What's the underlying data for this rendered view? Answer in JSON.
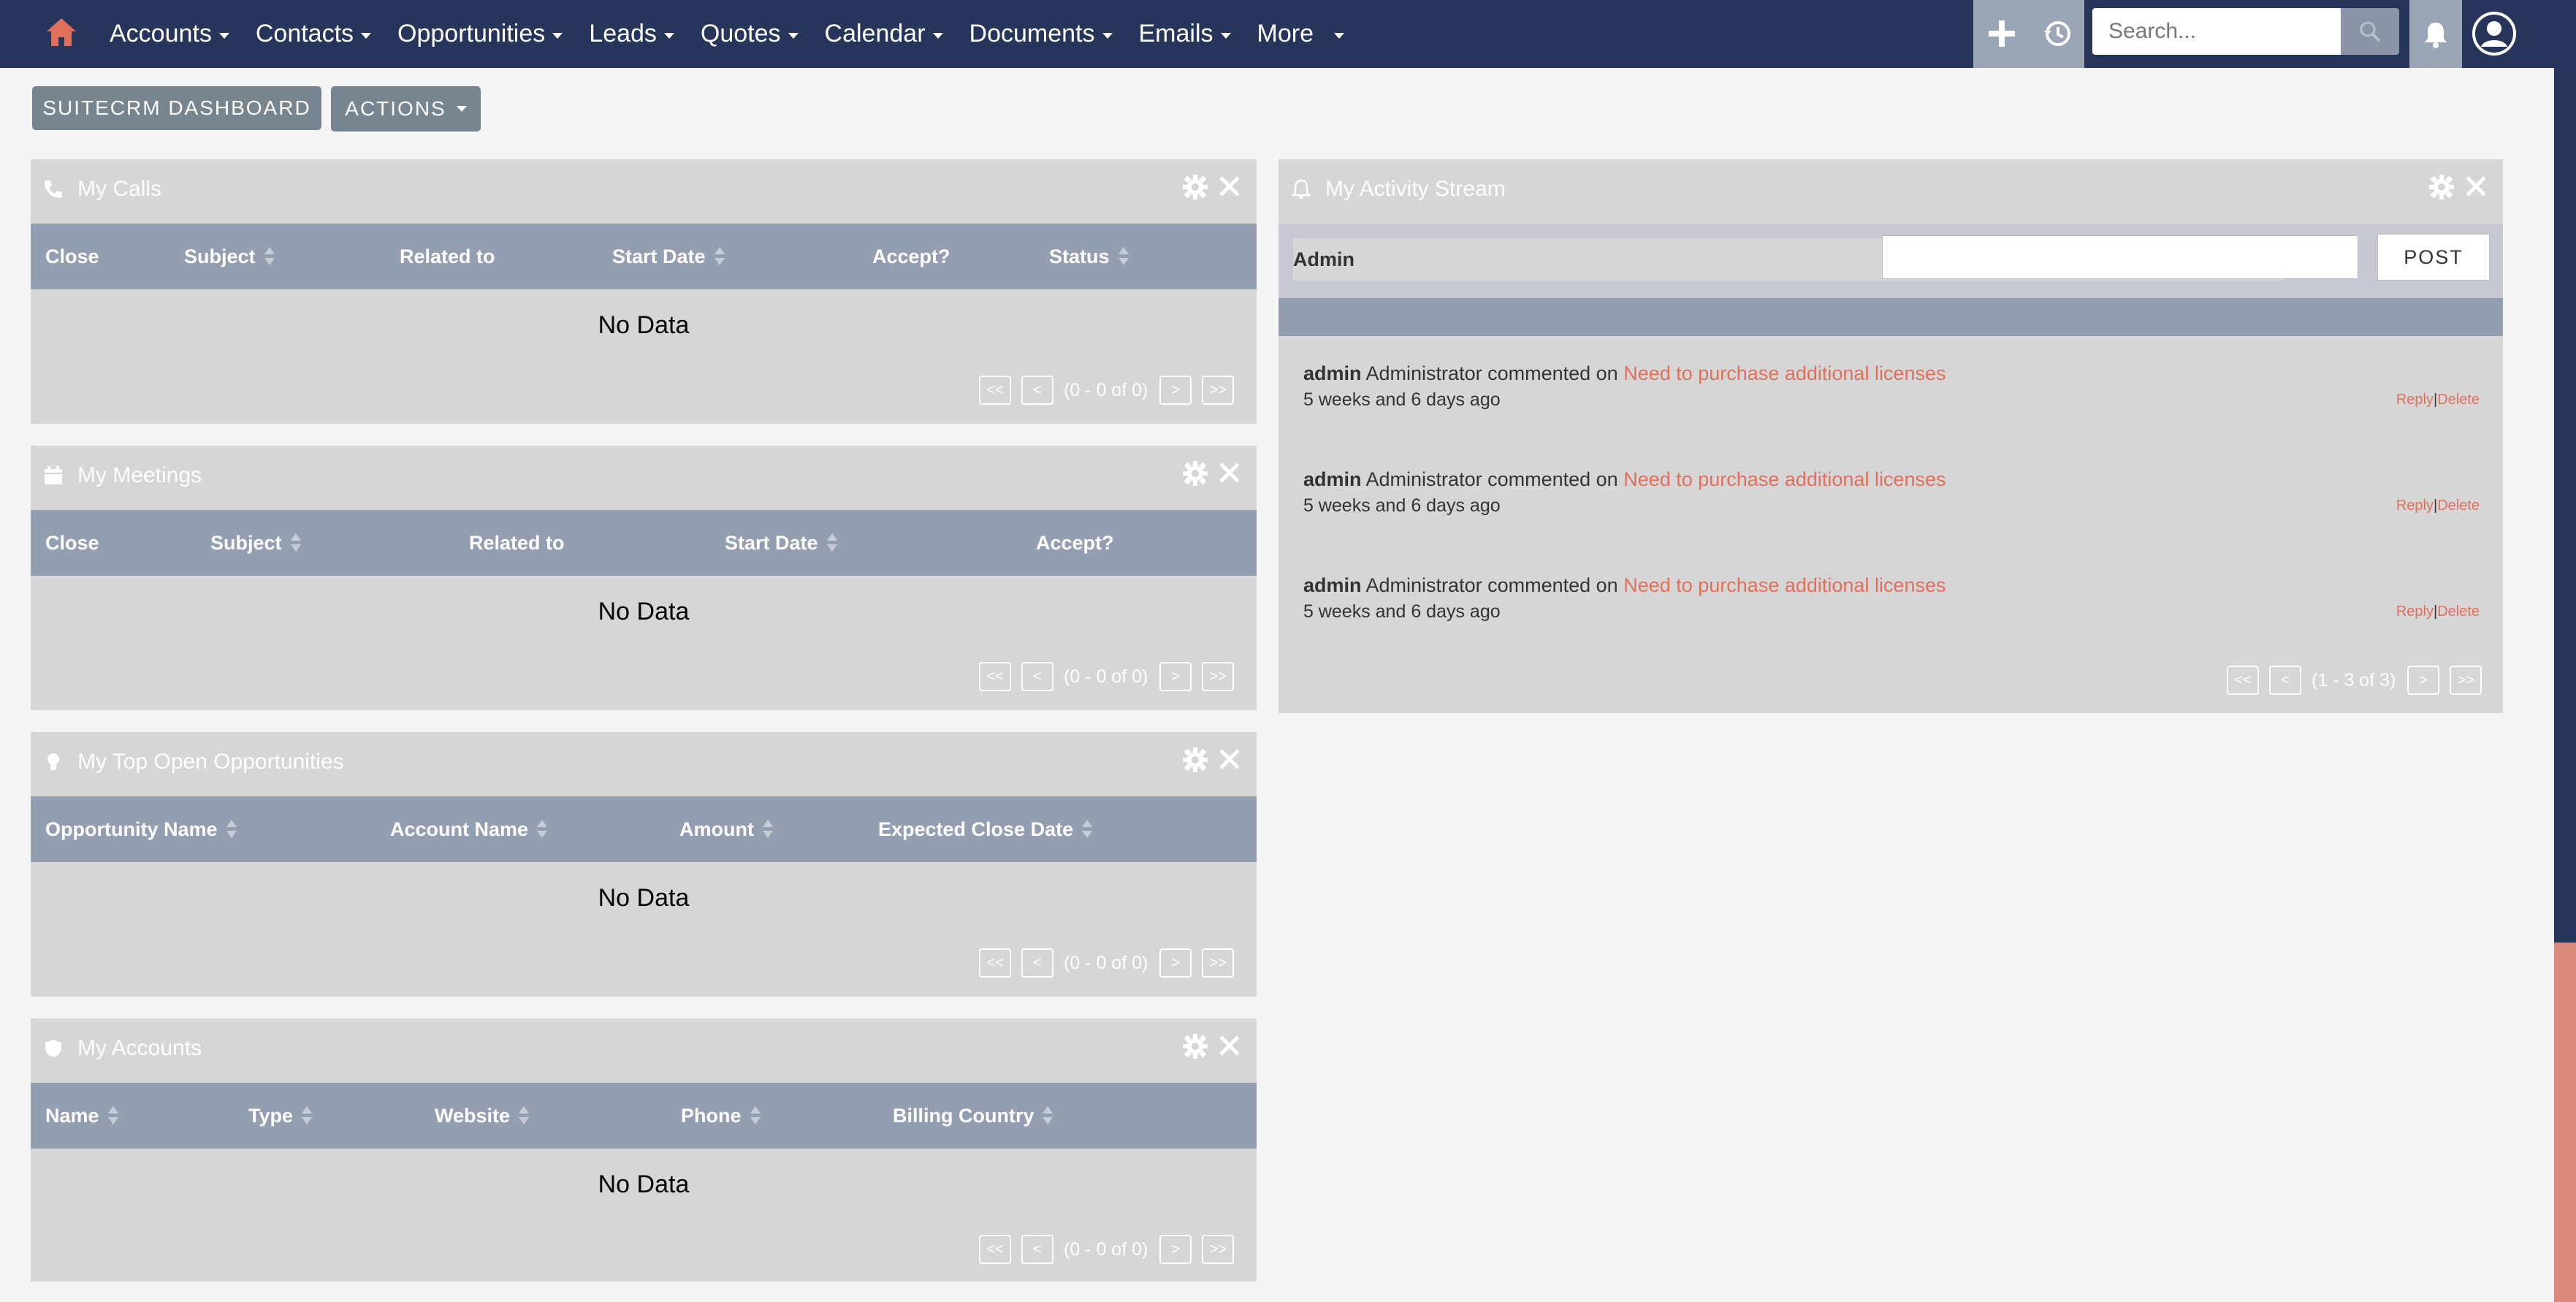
{
  "nav": {
    "items": [
      {
        "label": "Accounts"
      },
      {
        "label": "Contacts"
      },
      {
        "label": "Opportunities"
      },
      {
        "label": "Leads"
      },
      {
        "label": "Quotes"
      },
      {
        "label": "Calendar"
      },
      {
        "label": "Documents"
      },
      {
        "label": "Emails"
      },
      {
        "label": "More"
      }
    ],
    "search_placeholder": "Search...",
    "colors": {
      "bar": "#263559",
      "home": "#e0705c"
    }
  },
  "toolbar": {
    "dashboard_label": "SUITECRM DASHBOARD",
    "actions_label": "ACTIONS"
  },
  "dashlets": {
    "calls": {
      "title": "My Calls",
      "columns": [
        "Close",
        "Subject",
        "Related to",
        "Start Date",
        "Accept?",
        "Status"
      ],
      "empty": "No Data",
      "pager": {
        "first": "<<",
        "prev": "<",
        "count": "(0 - 0 of 0)",
        "next": ">",
        "last": ">>"
      }
    },
    "meetings": {
      "title": "My Meetings",
      "columns": [
        "Close",
        "Subject",
        "Related to",
        "Start Date",
        "Accept?"
      ],
      "empty": "No Data",
      "pager": {
        "first": "<<",
        "prev": "<",
        "count": "(0 - 0 of 0)",
        "next": ">",
        "last": ">>"
      }
    },
    "opportunities": {
      "title": "My Top Open Opportunities",
      "columns": [
        "Opportunity Name",
        "Account Name",
        "Amount",
        "Expected Close Date"
      ],
      "empty": "No Data",
      "pager": {
        "first": "<<",
        "prev": "<",
        "count": "(0 - 0 of 0)",
        "next": ">",
        "last": ">>"
      }
    },
    "accounts": {
      "title": "My Accounts",
      "columns": [
        "Name",
        "Type",
        "Website",
        "Phone",
        "Billing Country"
      ],
      "empty": "No Data",
      "pager": {
        "first": "<<",
        "prev": "<",
        "count": "(0 - 0 of 0)",
        "next": ">",
        "last": ">>"
      }
    },
    "activity": {
      "title": "My Activity Stream",
      "user_label": "Admin",
      "post_label": "POST",
      "entries": [
        {
          "user": "admin",
          "text": "Administrator commented on",
          "link": "Need to purchase additional licenses",
          "time": "5 weeks and 6 days ago",
          "reply": "Reply",
          "delete": "Delete"
        },
        {
          "user": "admin",
          "text": "Administrator commented on",
          "link": "Need to purchase additional licenses",
          "time": "5 weeks and 6 days ago",
          "reply": "Reply",
          "delete": "Delete"
        },
        {
          "user": "admin",
          "text": "Administrator commented on",
          "link": "Need to purchase additional licenses",
          "time": "5 weeks and 6 days ago",
          "reply": "Reply",
          "delete": "Delete"
        }
      ],
      "pager": {
        "first": "<<",
        "prev": "<",
        "count": "(1 - 3 of 3)",
        "next": ">",
        "last": ">>"
      }
    }
  }
}
